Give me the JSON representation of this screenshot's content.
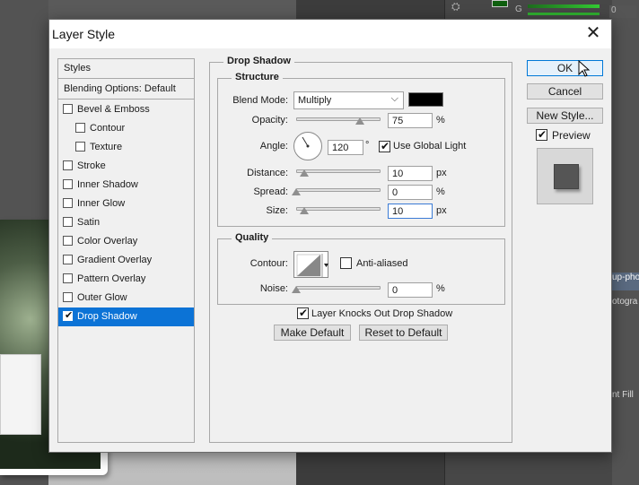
{
  "background": {
    "color_channel": "G",
    "color_value": "0",
    "layers": [
      "up-pho",
      "otogra",
      "nt Fill"
    ]
  },
  "dialog": {
    "title": "Layer Style"
  },
  "style_list": {
    "header_styles": "Styles",
    "header_blending": "Blending Options: Default",
    "items": [
      {
        "label": "Bevel & Emboss",
        "checked": false,
        "indent": false
      },
      {
        "label": "Contour",
        "checked": false,
        "indent": true
      },
      {
        "label": "Texture",
        "checked": false,
        "indent": true
      },
      {
        "label": "Stroke",
        "checked": false,
        "indent": false
      },
      {
        "label": "Inner Shadow",
        "checked": false,
        "indent": false
      },
      {
        "label": "Inner Glow",
        "checked": false,
        "indent": false
      },
      {
        "label": "Satin",
        "checked": false,
        "indent": false
      },
      {
        "label": "Color Overlay",
        "checked": false,
        "indent": false
      },
      {
        "label": "Gradient Overlay",
        "checked": false,
        "indent": false
      },
      {
        "label": "Pattern Overlay",
        "checked": false,
        "indent": false
      },
      {
        "label": "Outer Glow",
        "checked": false,
        "indent": false
      },
      {
        "label": "Drop Shadow",
        "checked": true,
        "indent": false,
        "selected": true
      }
    ]
  },
  "drop_shadow": {
    "section_title": "Drop Shadow",
    "structure": {
      "title": "Structure",
      "blend_mode_label": "Blend Mode:",
      "blend_mode_value": "Multiply",
      "shadow_color": "#000000",
      "opacity_label": "Opacity:",
      "opacity_value": "75",
      "opacity_unit": "%",
      "angle_label": "Angle:",
      "angle_value": "120",
      "angle_unit": "°",
      "global_light_label": "Use Global Light",
      "global_light_checked": true,
      "distance_label": "Distance:",
      "distance_value": "10",
      "distance_unit": "px",
      "spread_label": "Spread:",
      "spread_value": "0",
      "spread_unit": "%",
      "size_label": "Size:",
      "size_value": "10",
      "size_unit": "px"
    },
    "quality": {
      "title": "Quality",
      "contour_label": "Contour:",
      "anti_aliased_label": "Anti-aliased",
      "anti_aliased_checked": false,
      "noise_label": "Noise:",
      "noise_value": "0",
      "noise_unit": "%"
    },
    "knockout_label": "Layer Knocks Out Drop Shadow",
    "knockout_checked": true,
    "make_default_label": "Make Default",
    "reset_default_label": "Reset to Default"
  },
  "side_buttons": {
    "ok_label": "OK",
    "cancel_label": "Cancel",
    "new_style_label": "New Style...",
    "preview_label": "Preview",
    "preview_checked": true
  },
  "colors": {
    "selection": "#0c73d6",
    "ok_border": "#0078d7"
  }
}
